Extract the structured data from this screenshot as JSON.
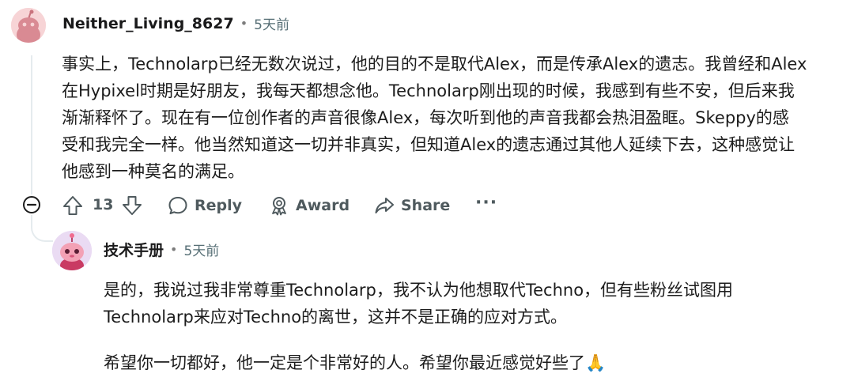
{
  "comment": {
    "username": "Neither_Living_8627",
    "separator": "•",
    "time": "5天前",
    "lines": [
      "事实上，Technolarp已经无数次说过，他的目的不是取代Alex，而是传承Alex的遗志。我曾经和Alex",
      "在Hypixel时期是好朋友，我每天都想念他。Technolarp刚出现的时候，我感到有些不安，但后来我",
      "渐渐释怀了。现在有一位创作者的声音很像Alex，每次听到他的声音我都会热泪盈眶。Skeppy的感",
      "受和我完全一样。他当然知道这一切并非真实，但知道Alex的遗志通过其他人延续下去，这种感觉让",
      "他感到一种莫名的满足。"
    ],
    "actions": {
      "vote_count": "13",
      "reply": "Reply",
      "award": "Award",
      "share": "Share",
      "more": "···"
    }
  },
  "reply": {
    "username": "技术手册",
    "separator": "•",
    "time": "5天前",
    "paragraph1": [
      "是的，我说过我非常尊重Technolarp，我不认为他想取代Techno，但有些粉丝试图用",
      "Technolarp来应对Techno的离世，这并不是正确的应对方式。"
    ],
    "paragraph2": "希望你一切都好，他一定是个非常好的人。希望你最近感觉好些了🙏"
  },
  "colors": {
    "avatar1_bg": "#f7d4d6",
    "avatar2_bg": "#e7d7f3",
    "thread_line": "#e5ebee",
    "meta_text": "#576f76",
    "action_text": "#4f5a5e"
  },
  "icons": [
    "collapse-icon",
    "upvote-icon",
    "downvote-icon",
    "reply-icon",
    "award-icon",
    "share-icon",
    "more-icon"
  ]
}
